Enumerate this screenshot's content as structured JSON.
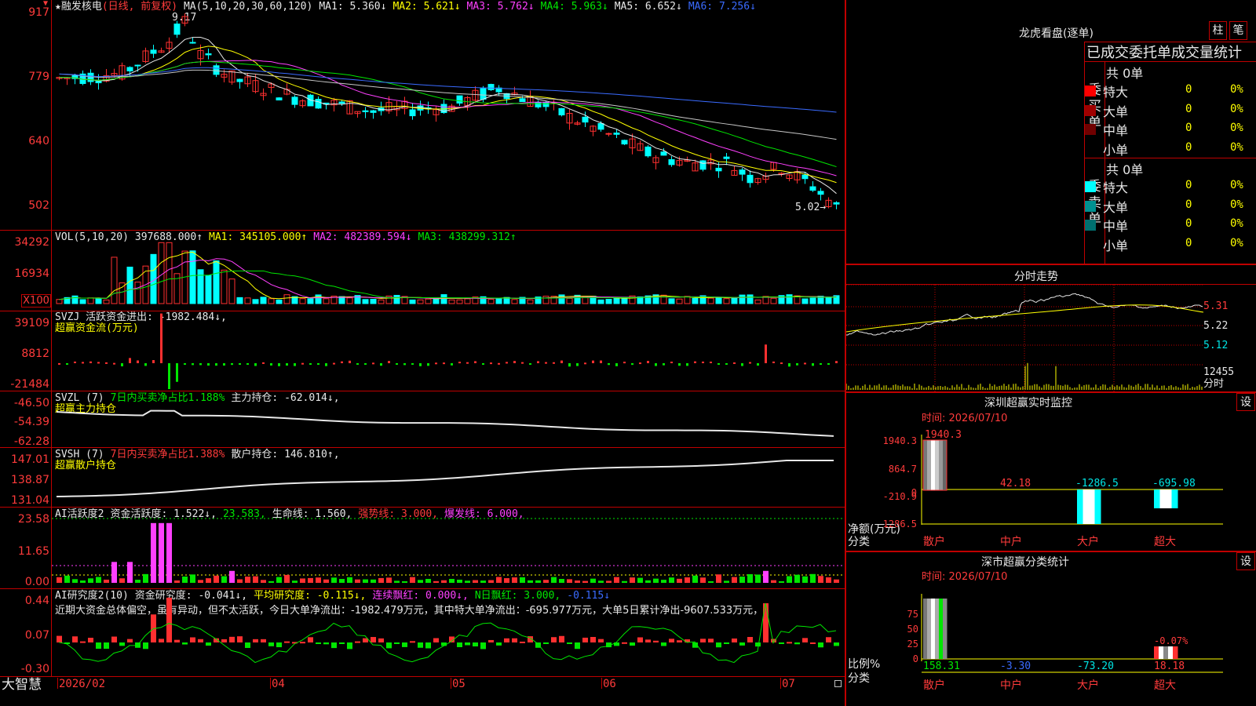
{
  "app": {
    "brand": "大智慧"
  },
  "main": {
    "title": "★融发核电",
    "period": "(日线, 前复权)",
    "ma_legend": [
      {
        "text": "MA(5,10,20,30,60,120)",
        "color": "#e8e8e8"
      },
      {
        "text": "MA1: 5.360↓",
        "color": "#e8e8e8"
      },
      {
        "text": "MA2: 5.621↓",
        "color": "#ffff00"
      },
      {
        "text": "MA3: 5.762↓",
        "color": "#ff40ff"
      },
      {
        "text": "MA4: 5.963↓",
        "color": "#00e600"
      },
      {
        "text": "MA5: 6.652↓",
        "color": "#e8e8e8"
      },
      {
        "text": "MA6: 7.256↓",
        "color": "#3a6bff"
      }
    ],
    "y_labels": [
      "917",
      "779",
      "640",
      "502"
    ],
    "high_label": "9.17",
    "low_label": "5.02→",
    "date_labels": [
      "2026/02",
      "04",
      "05",
      "06",
      "07"
    ]
  },
  "vol": {
    "legend": [
      {
        "text": "VOL(5,10,20)",
        "color": "#e8e8e8"
      },
      {
        "text": "397688.000↑",
        "color": "#e8e8e8"
      },
      {
        "text": "MA1: 345105.000↑",
        "color": "#ffff00"
      },
      {
        "text": "MA2: 482389.594↓",
        "color": "#ff40ff"
      },
      {
        "text": "MA3: 438299.312↑",
        "color": "#00e600"
      }
    ],
    "y_labels": [
      "34292",
      "16934",
      "X100"
    ]
  },
  "svzj": {
    "legend": [
      {
        "text": "SVZJ  活跃资金进出: -1982.484↓,",
        "color": "#e8e8e8"
      }
    ],
    "name": "超赢资金流(万元)",
    "y_labels": [
      "39109",
      "8812",
      "-21484"
    ]
  },
  "svzl": {
    "legend": [
      {
        "text": "SVZL (7)",
        "color": "#e8e8e8"
      },
      {
        "text": "7日内买卖净占比1.188%",
        "color": "#00e600"
      },
      {
        "text": "主力持仓: -62.014↓,",
        "color": "#e8e8e8"
      }
    ],
    "name": "超赢主力持仓",
    "y_labels": [
      "-46.50",
      "-54.39",
      "-62.28"
    ]
  },
  "svsh": {
    "legend": [
      {
        "text": "SVSH (7)",
        "color": "#e8e8e8"
      },
      {
        "text": "7日内买卖净占比1.388%",
        "color": "#ff3b3b"
      },
      {
        "text": "散户持仓: 146.810↑,",
        "color": "#e8e8e8"
      }
    ],
    "name": "超赢散户持仓",
    "y_labels": [
      "147.01",
      "138.87",
      "131.04"
    ]
  },
  "ai1": {
    "legend": [
      {
        "text": "AI活跃度2",
        "color": "#e8e8e8"
      },
      {
        "text": "资金活跃度: 1.522↓,",
        "color": "#e8e8e8"
      },
      {
        "text": "23.583,",
        "color": "#00e600"
      },
      {
        "text": "生命线: 1.560,",
        "color": "#e8e8e8"
      },
      {
        "text": "强势线: 3.000,",
        "color": "#ff3b3b"
      },
      {
        "text": "爆发线: 6.000,",
        "color": "#ff40ff"
      }
    ],
    "y_labels": [
      "23.58",
      "11.65",
      "0.00"
    ]
  },
  "ai2": {
    "legend": [
      {
        "text": "AI研究度2(10)",
        "color": "#e8e8e8"
      },
      {
        "text": "资金研究度: -0.041↓,",
        "color": "#e8e8e8"
      },
      {
        "text": "平均研究度: -0.115↓,",
        "color": "#ffff00"
      },
      {
        "text": "连续飘红: 0.000↓,",
        "color": "#ff40ff"
      },
      {
        "text": "N日飘红: 3.000,",
        "color": "#00e600"
      },
      {
        "text": "-0.115↓",
        "color": "#3a6bff"
      }
    ],
    "comment": "近期大资金总体偏空，虽有异动，但不太活跃，今日大单净流出：-1982.479万元，其中特大单净流出：-695.977万元，大单5日累计净出-9607.533万元，",
    "y_labels": [
      "0.44",
      "0.07",
      "-0.30"
    ]
  },
  "right": {
    "longhu": {
      "title": "龙虎看盘(逐单)",
      "btn_bar": "柱",
      "btn_pen": "笔",
      "subtitle": "已成交委托单成交量统计",
      "buy": {
        "label_chars": [
          "委",
          "买",
          "单"
        ],
        "total": "共 0单",
        "rows": [
          {
            "name": "特大",
            "count": "0",
            "pct": "0%",
            "color": "#ff0000"
          },
          {
            "name": "大单",
            "count": "0",
            "pct": "0%",
            "color": "#a00000"
          },
          {
            "name": "中单",
            "count": "0",
            "pct": "0%",
            "color": "#700000"
          },
          {
            "name": "小单",
            "count": "0",
            "pct": "0%",
            "color": "#000000"
          }
        ]
      },
      "sell": {
        "label_chars": [
          "委",
          "卖",
          "单"
        ],
        "total": "共 0单",
        "rows": [
          {
            "name": "特大",
            "count": "0",
            "pct": "0%",
            "color": "#00ffff"
          },
          {
            "name": "大单",
            "count": "0",
            "pct": "0%",
            "color": "#009090"
          },
          {
            "name": "中单",
            "count": "0",
            "pct": "0%",
            "color": "#007070"
          },
          {
            "name": "小单",
            "count": "0",
            "pct": "0%",
            "color": "#000000"
          }
        ]
      }
    },
    "intraday": {
      "title": "分时走势",
      "y_labels": [
        "5.31",
        "5.22",
        "5.12"
      ],
      "vol_label": "12455",
      "tag": "分时"
    },
    "monitor": {
      "title": "深圳超赢实时监控",
      "btn": "设",
      "time": "时间: 2026/07/10",
      "y_labels": [
        "1940.3",
        "864.7",
        "0",
        "-210.9",
        "-1286.5"
      ],
      "value_labels": [
        "1940.3",
        "42.18",
        "-1286.5",
        "-695.98"
      ],
      "axis_title": "净额(万元)",
      "axis_cat": "分类",
      "categories": [
        "散户",
        "中户",
        "大户",
        "超大"
      ]
    },
    "classify": {
      "title": "深市超赢分类统计",
      "btn": "设",
      "time": "时间: 2026/07/10",
      "y_labels": [
        "75",
        "50",
        "25",
        "0"
      ],
      "top_label": "-0.07%",
      "values": [
        "158.31",
        "-3.30",
        "-73.20",
        "18.18"
      ],
      "axis_title": "比例%",
      "axis_cat": "分类",
      "categories": [
        "散户",
        "中户",
        "大户",
        "超大"
      ]
    }
  }
}
